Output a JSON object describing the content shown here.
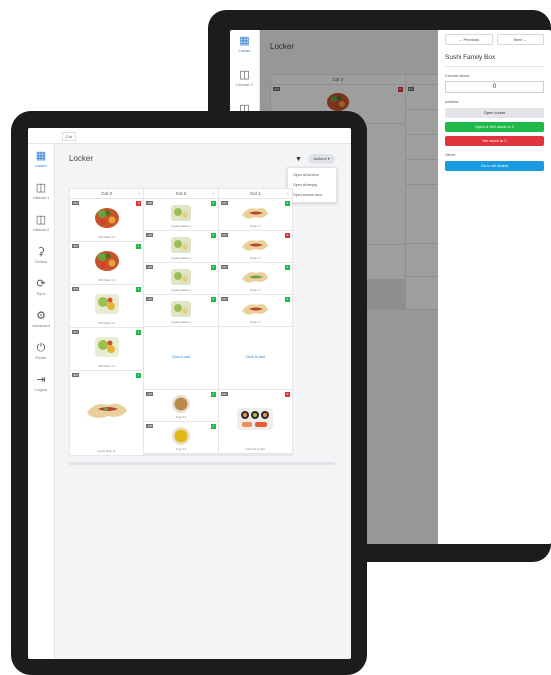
{
  "back": {
    "sidebar": [
      {
        "label": "Locker",
        "icon": "grid-icon",
        "active": true
      },
      {
        "label": "Lifemat 3",
        "icon": "fridge-icon"
      }
    ],
    "title": "Locker",
    "cols": [
      {
        "head": "Col 3"
      },
      {
        "head": "Col 2"
      }
    ],
    "empty_label": "Click to add",
    "panel": {
      "prev_label": "← Previous",
      "next_label": "Next →",
      "title": "Sushi Family Box",
      "stock_label": "Current stock:",
      "stock_value": "0",
      "actions_label": "Actions:",
      "open_locker": "Open locker",
      "open_set_stock": "Open & Set stock to 1",
      "set_stock_zero": "Set stock to 0",
      "other_label": "Other:",
      "go_to_orders": "Go to all orders"
    }
  },
  "front": {
    "top_select": "Col",
    "sidebar": [
      {
        "label": "Locker",
        "icon": "grid-icon",
        "active": true
      },
      {
        "label": "Lifemat 1",
        "icon": "fridge-icon"
      },
      {
        "label": "Lifemat 2",
        "icon": "fridge-icon"
      },
      {
        "label": "Orders",
        "icon": "cart-icon"
      },
      {
        "label": "Sync",
        "icon": "sync-icon"
      },
      {
        "label": "Advanced",
        "icon": "gear-icon"
      },
      {
        "label": "Power",
        "icon": "power-icon"
      },
      {
        "label": "Logout",
        "icon": "logout-icon"
      }
    ],
    "title": "Locker",
    "actions_label": "Actions ▾",
    "menu": [
      "Open all lockers",
      "Open all empty",
      "Open service door"
    ],
    "cols": [
      {
        "head": "Col 3"
      },
      {
        "head": "Col 2"
      },
      {
        "head": "Col 1"
      }
    ],
    "cells": {
      "salad": "Wild Salad 1.9",
      "caesar": "Ceasar Salad 2.1",
      "wrap": "Wrap 1.4",
      "soup": "Soup 0.9",
      "sushi": "Sushi Family Box",
      "family": "Family Wrap XL",
      "empty": "Click to add"
    }
  },
  "colors": {
    "accent": "#2e7fd6",
    "green": "#1fb84a",
    "red": "#e0333d",
    "blue": "#1a9be0",
    "bezel": "#1c1c1c"
  }
}
